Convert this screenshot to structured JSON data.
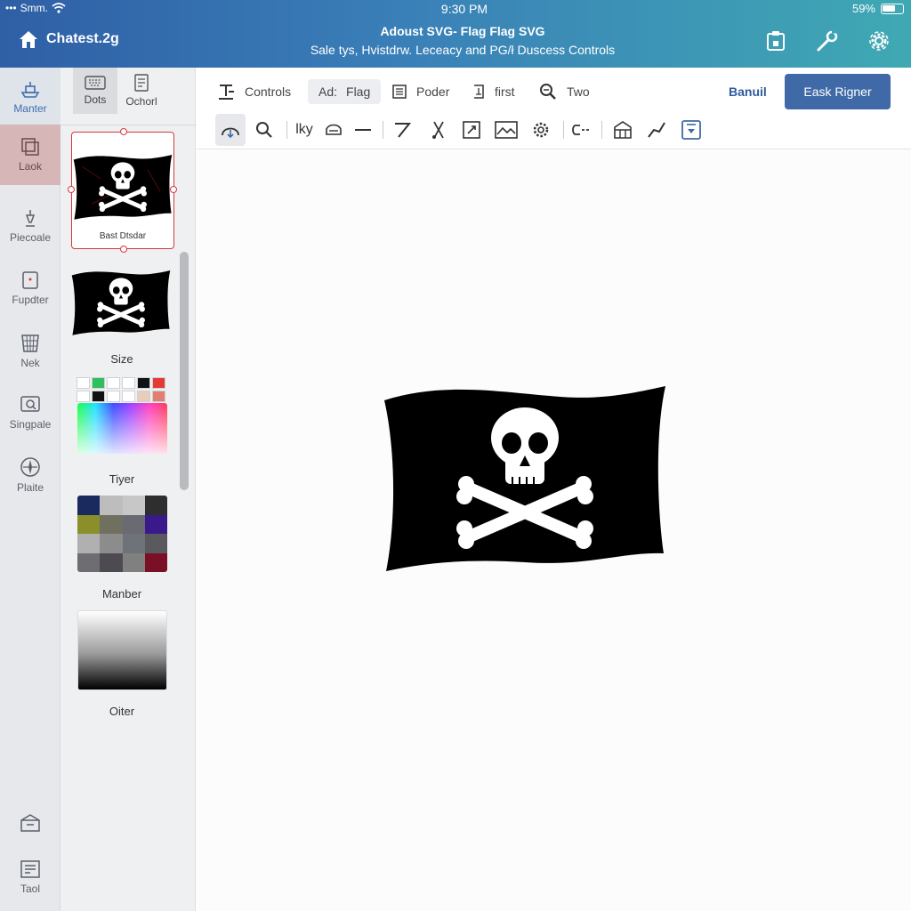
{
  "status_bar": {
    "carrier": "Smm.",
    "time": "9:30 PM",
    "battery": "59%"
  },
  "header": {
    "brand": "Chatest.2g",
    "title": "Adoust SVG- Flag Flag SVG",
    "subtitle": "Sale tys, Hvistdrw. Leceacy and PG/ł Duscess Controls",
    "icons": [
      "clipboard-icon",
      "wrench-icon",
      "gear-icon"
    ]
  },
  "rail": {
    "items": [
      {
        "label": "Manter",
        "icon": "ship-icon"
      },
      {
        "label": "Laok",
        "icon": "cards-icon"
      },
      {
        "label": "Piecoale",
        "icon": "pen-tool-icon"
      },
      {
        "label": "Fupdter",
        "icon": "document-icon"
      },
      {
        "label": "Nek",
        "icon": "basket-icon"
      },
      {
        "label": "Singpale",
        "icon": "search-box-icon"
      },
      {
        "label": "Plaite",
        "icon": "compass-icon"
      }
    ],
    "bottom": [
      {
        "label": "",
        "icon": "box-icon"
      },
      {
        "label": "Taol",
        "icon": "image-frame-icon"
      }
    ]
  },
  "panel": {
    "tabs": [
      {
        "label": "Dots",
        "icon": "keyboard-icon"
      },
      {
        "label": "Ochorl",
        "icon": "page-icon"
      }
    ],
    "selected_card_label": "Bast Dtsdar",
    "labels": {
      "size": "Size",
      "tiyer": "Tiyer",
      "manber": "Manber",
      "oiter": "Oiter"
    },
    "swatches": [
      "#ffffff",
      "#2fbf5c",
      "#ffffff",
      "#ffffff",
      "#111111",
      "#e53935",
      "#ffffff",
      "#111111",
      "#ffffff",
      "#ffffff",
      "#e8cdb8",
      "#e07f72"
    ],
    "palette": [
      "#1b2a5e",
      "#bdbdbd",
      "#c7c7c7",
      "#2e2e2e",
      "#8a8f2a",
      "#707060",
      "#6a6a72",
      "#3a1a8a",
      "#b0b0b0",
      "#8c8c8c",
      "#6d7378",
      "#5a5a5e",
      "#6e6e72",
      "#4e4a52",
      "#808080",
      "#7a1025"
    ]
  },
  "toolbar": {
    "controls_label": "Controls",
    "add_prefix": "Ad:",
    "flag_label": "Flag",
    "poder_label": "Poder",
    "first_label": "first",
    "two_label": "Two",
    "link_label": "Banuil",
    "primary_label": "Eask Rigner",
    "tool_text": "lky"
  },
  "colors": {
    "accent": "#3f69a7",
    "selection": "#d8383c",
    "header_start": "#2f5fa6",
    "header_end": "#3fa9b3"
  }
}
